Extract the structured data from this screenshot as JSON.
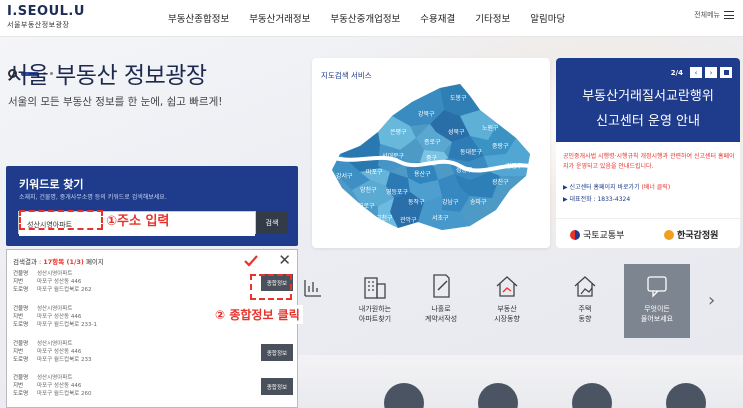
{
  "header": {
    "logo_main": "I.SEOUL.U",
    "logo_sub": "서울부동산정보광장",
    "nav": [
      "부동산종합정보",
      "부동산거래정보",
      "부동산중개업정보",
      "수용재결",
      "기타정보",
      "알림마당"
    ],
    "all_menu": "전체메뉴"
  },
  "hero": {
    "title": "서울 부동산 정보광장",
    "subtitle": "서울의 모든 부동산 정보를 한 눈에, 쉽고 빠르게!"
  },
  "keyword_search": {
    "title": "키워드로 찾기",
    "description": "소재지, 건물명, 중개사무소명 등의 키워드로 검색해보세요.",
    "input_value": "성산시영아파트",
    "button": "검색"
  },
  "annotations": {
    "step1": "①주소 입력",
    "step2": "② 종합정보 클릭"
  },
  "results": {
    "prefix": "검색결과 : ",
    "count": "17항목 (1/3)",
    "suffix": " 페이지",
    "labels": [
      "건물명",
      "지번",
      "도로명"
    ],
    "button": "종합정보",
    "items": [
      {
        "name": "성산시영아파트",
        "jibun": "마포구 성산동 446",
        "road": "마포구 월드컵북로 262"
      },
      {
        "name": "성산시영아파트",
        "jibun": "마포구 성산동 446",
        "road": "마포구 월드컵북로 233-1"
      },
      {
        "name": "성산시영아파트",
        "jibun": "마포구 성산동 446",
        "road": "마포구 월드컵북로 233"
      },
      {
        "name": "성산시영아파트",
        "jibun": "마포구 성산동 446",
        "road": "마포구 월드컵북로 260"
      }
    ]
  },
  "map": {
    "title": "지도검색 서비스",
    "districts": [
      "도봉구",
      "노원구",
      "강북구",
      "은평구",
      "성북구",
      "중랑구",
      "종로구",
      "동대문구",
      "서대문구",
      "강서구",
      "마포구",
      "중구",
      "성동구",
      "광진구",
      "강동구",
      "용산구",
      "양천구",
      "영등포구",
      "동작구",
      "송파구",
      "구로구",
      "강남구",
      "관악구",
      "서초구",
      "금천구"
    ]
  },
  "notice": {
    "page": "2/4",
    "title_line1": "부동산거래질서교란행위",
    "title_line2": "신고센터 운영 안내",
    "body": "공인중개사법 시행령·시행규칙 개정시행과 관련하여 신고센터 홈페이지가 운영되고 있음을 안내드립니다.",
    "link1_text": "신고센터 홈페이지 바로가기 ",
    "link1_note": "(배너 클릭)",
    "link2": "대표전화 : 1833-4324",
    "logo1": "국토교통부",
    "logo2": "한국감정원"
  },
  "quick_menu": [
    {
      "label": "",
      "icon": "chart-icon"
    },
    {
      "label": "내가원하는\n아파트찾기",
      "icon": "apartment-icon"
    },
    {
      "label": "나홀로\n계약서작성",
      "icon": "contract-icon"
    },
    {
      "label": "부동산\n시장동향",
      "icon": "market-trend-icon"
    },
    {
      "label": "주택\n동향",
      "icon": "house-trend-icon"
    },
    {
      "label": "무엇이든\n물어보세요",
      "icon": "qna-icon"
    }
  ],
  "colors": {
    "primary": "#1e3b8c",
    "annotation_red": "#e8322c",
    "header_text": "#1c2c55"
  }
}
